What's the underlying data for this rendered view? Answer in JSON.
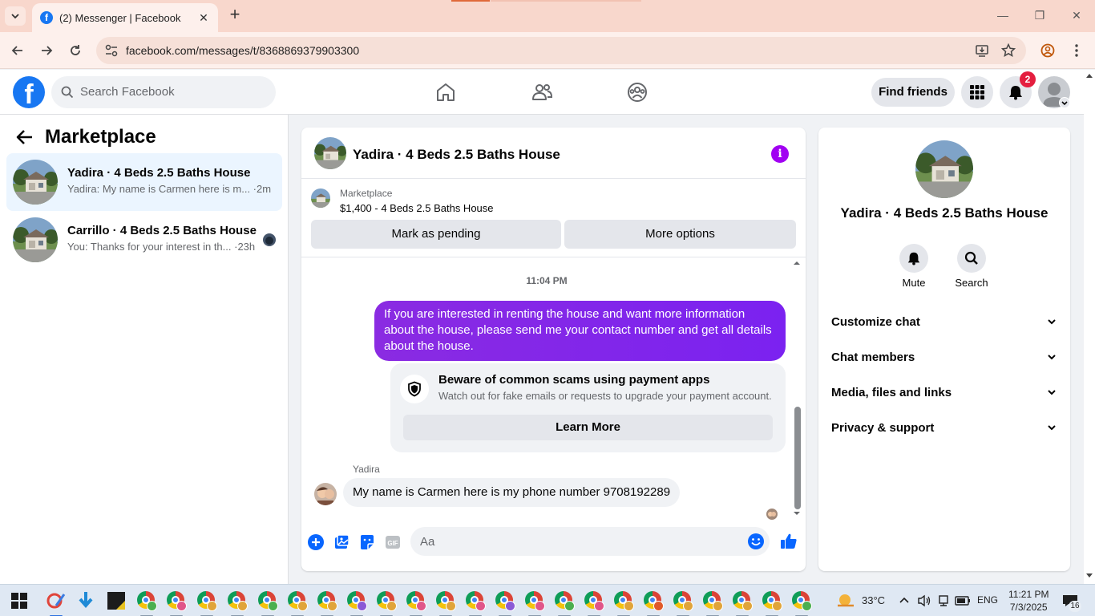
{
  "browser": {
    "tab_title": "(2) Messenger | Facebook",
    "url": "facebook.com/messages/t/8368869379903300"
  },
  "fb": {
    "search_placeholder": "Search Facebook",
    "find_friends": "Find friends",
    "notification_count": "2"
  },
  "left": {
    "title": "Marketplace",
    "conversations": [
      {
        "name": "Yadira · 4 Beds 2.5 Baths House",
        "snippet": "Yadira: My name is Carmen here is m... ·2m",
        "active": true
      },
      {
        "name": "Carrillo · 4 Beds 2.5 Baths House",
        "snippet": "You: Thanks for your interest in th... ·23h",
        "active": false
      }
    ]
  },
  "chat": {
    "header_name": "Yadira · 4 Beds 2.5 Baths House",
    "marketplace_label": "Marketplace",
    "listing": "$1,400 - 4 Beds 2.5 Baths House",
    "mark_pending": "Mark as pending",
    "more_options": "More options",
    "timestamp": "11:04 PM",
    "outgoing_message": "If you are interested in renting the house and want more information about the house, please send me your contact number and get all details about the house.",
    "scam_title": "Beware of common scams using payment apps",
    "scam_desc": "Watch out for fake emails or requests to upgrade your payment account.",
    "learn_more": "Learn More",
    "sender": "Yadira",
    "incoming_message": "My name is Carmen here is my phone number 9708192289",
    "composer_placeholder": "Aa"
  },
  "info_panel": {
    "name": "Yadira · 4 Beds 2.5 Baths House",
    "actions": [
      "Mute",
      "Search"
    ],
    "sections": [
      "Customize chat",
      "Chat members",
      "Media, files and links",
      "Privacy & support"
    ]
  },
  "taskbar": {
    "weather": "33°C",
    "language": "ENG",
    "time": "11:21 PM",
    "date": "7/3/2025",
    "notification_count": "16"
  },
  "colors": {
    "fb_blue": "#1877f2",
    "messenger_purple": "#7b22f0",
    "badge_red": "#e41e3f"
  },
  "icons": [
    "tab-search-icon",
    "facebook-logo",
    "home-icon",
    "friends-icon",
    "groups-icon",
    "menu-grid-icon",
    "bell-icon",
    "info-icon",
    "shield-icon",
    "bell-mute-icon",
    "search-icon",
    "chevron-down-icon",
    "plus-icon",
    "image-icon",
    "sticker-icon",
    "gif-icon",
    "emoji-icon",
    "like-icon"
  ]
}
